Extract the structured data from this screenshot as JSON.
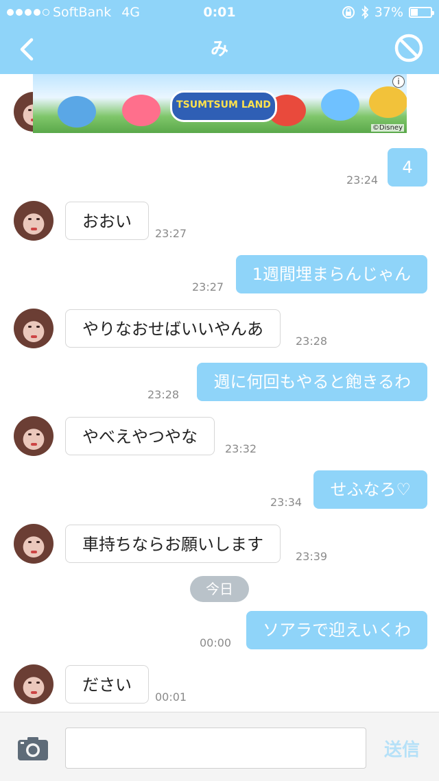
{
  "status_bar": {
    "carrier": "SoftBank",
    "network": "4G",
    "time": "0:01",
    "battery": "37%",
    "battery_level": 0.37
  },
  "header": {
    "title": "み",
    "back_icon": "chevron-left-icon",
    "block_icon": "block-icon"
  },
  "ad": {
    "logo_text": "TSUMTSUM LAND",
    "copyright": "©Disney",
    "info": "i"
  },
  "messages": [
    {
      "text": "4",
      "time": "23:24"
    },
    {
      "text": "おおい",
      "time": "23:27"
    },
    {
      "text": "1週間埋まらんじゃん",
      "time": "23:27"
    },
    {
      "text": "やりなおせばいいやんあ",
      "time": "23:28"
    },
    {
      "text": "週に何回もやると飽きるわ",
      "time": "23:28"
    },
    {
      "text": "やべえやつやな",
      "time": "23:32"
    },
    {
      "text": "せふなろ♡",
      "time": "23:34"
    },
    {
      "text": "車持ちならお願いします",
      "time": "23:39"
    },
    {
      "text": "ソアラで迎えいくわ",
      "time": "00:00"
    },
    {
      "text": "ださい",
      "time": "00:01"
    }
  ],
  "date_separator": "今日",
  "composer": {
    "input_value": "",
    "send_label": "送信",
    "camera_icon": "camera-icon"
  },
  "colors": {
    "header": "#8fd4f9",
    "outgoing_bubble": "#8fd4f9",
    "send_disabled": "#b6e1f8"
  }
}
